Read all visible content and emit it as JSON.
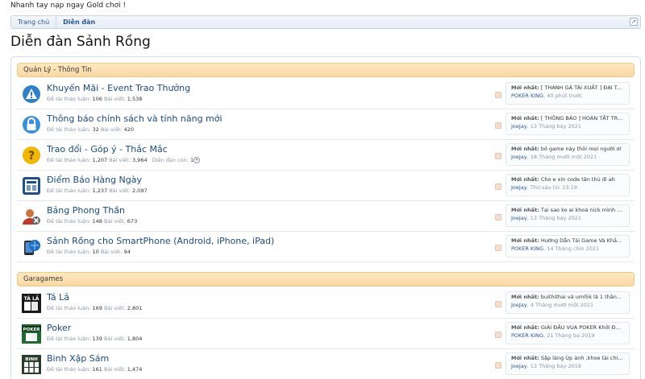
{
  "notice": "Nhanh tay nạp ngay Gold chơi !",
  "breadcrumb": {
    "home": "Trang chủ",
    "current": "Diễn đàn",
    "jump_icon": "jump-arrow-icon"
  },
  "page_title": "Diễn đàn Sảnh Rồng",
  "categories": [
    {
      "title": "Quản Lý - Thông Tin",
      "forums": [
        {
          "icon": "warning-icon",
          "title": "Khuyến Mãi - Event Trao Thưởng",
          "threads_label": "Đề tài thảo luận:",
          "threads": "106",
          "posts_label": "Bài viết:",
          "posts": "1,538",
          "latest_label": "Mới nhất:",
          "latest_title": "[ THÁNH GÀ TÁI XUẤT ] ĐẠI T...",
          "latest_user": "POKER KING",
          "latest_time": "40 phút trước"
        },
        {
          "icon": "lock-icon",
          "title": "Thông báo chính sách và tính năng mới",
          "threads_label": "Đề tài thảo luận:",
          "threads": "32",
          "posts_label": "Bài viết:",
          "posts": "420",
          "latest_label": "Mới nhất:",
          "latest_title": "[ THÔNG BÁO ] HOÀN TẤT TR...",
          "latest_user": "JoeJay",
          "latest_time": "13 Tháng bảy 2021"
        },
        {
          "icon": "question-icon",
          "title": "Trao đổi - Góp ý - Thắc Mắc",
          "threads_label": "Đề tài thảo luận:",
          "threads": "1,207",
          "posts_label": "Bài viết:",
          "posts": "3,964",
          "sub_label": "Diễn đàn con:",
          "sub_count": "1",
          "latest_label": "Mới nhất:",
          "latest_title": "bỏ game này thôi mọi người ơi",
          "latest_user": "JoeJay",
          "latest_time": "18 Tháng mười một 2021"
        },
        {
          "icon": "calendar-icon",
          "title": "Điểm Báo Hàng Ngày",
          "threads_label": "Đề tài thảo luận:",
          "threads": "1,237",
          "posts_label": "Bài viết:",
          "posts": "2,097",
          "latest_label": "Mới nhất:",
          "latest_title": "Cho e xin code tân thủ đi ah",
          "latest_user": "JoeJay",
          "latest_time": "Thứ sáu lúc 13:19"
        },
        {
          "icon": "banned-user-icon",
          "title": "Bảng Phong Thần",
          "threads_label": "Đề tài thảo luận:",
          "threads": "148",
          "posts_label": "Bài viết:",
          "posts": "673",
          "latest_label": "Mới nhất:",
          "latest_title": "Tại sao ko ai khoá nick mình ...",
          "latest_user": "JoeJay",
          "latest_time": "13 Tháng bảy 2021"
        },
        {
          "icon": "smartphone-icon",
          "title": "Sảnh Rồng cho SmartPhone (Android, iPhone, iPad)",
          "threads_label": "Đề tài thảo luận:",
          "threads": "10",
          "posts_label": "Bài viết:",
          "posts": "94",
          "latest_label": "Mới nhất:",
          "latest_title": "Hướng Dẫn Tải Game Và Khắ...",
          "latest_user": "POKER KING",
          "latest_time": "14 Tháng chín 2021"
        }
      ]
    },
    {
      "title": "Garagames",
      "forums": [
        {
          "icon": "tala-game-icon",
          "icon_text": "TÁ LẢ",
          "title": "Tá Lả",
          "threads_label": "Đề tài thảo luận:",
          "threads": "169",
          "posts_label": "Bài viết:",
          "posts": "2,801",
          "latest_label": "Mới nhất:",
          "latest_title": "buithithai và uml5k là 1 thằn...",
          "latest_user": "JoeJay",
          "latest_time": "4 Tháng mười một 2021"
        },
        {
          "icon": "poker-game-icon",
          "icon_text": "POKER",
          "title": "Poker",
          "threads_label": "Đề tài thảo luận:",
          "threads": "139",
          "posts_label": "Bài viết:",
          "posts": "1,804",
          "latest_label": "Mới nhất:",
          "latest_title": "GIẢI ĐẤU VUA POKER Khởi Đ...",
          "latest_user": "POKER KING",
          "latest_time": "21 Tháng ba 2019"
        },
        {
          "icon": "binh-game-icon",
          "icon_text": "BINH",
          "title": "Binh Xập Sám",
          "threads_label": "Đề tài thảo luận:",
          "threads": "161",
          "posts_label": "Bài viết:",
          "posts": "1,474",
          "latest_label": "Mới nhất:",
          "latest_title": "Sập làng Úp ảnh ,khoe tài chi...",
          "latest_user": "JoeJay",
          "latest_time": "13 Tháng bảy 2018"
        }
      ]
    }
  ],
  "colors": {
    "link": "#174a85",
    "category_bg": "#f9d9a2",
    "muted": "#8a96a3"
  }
}
